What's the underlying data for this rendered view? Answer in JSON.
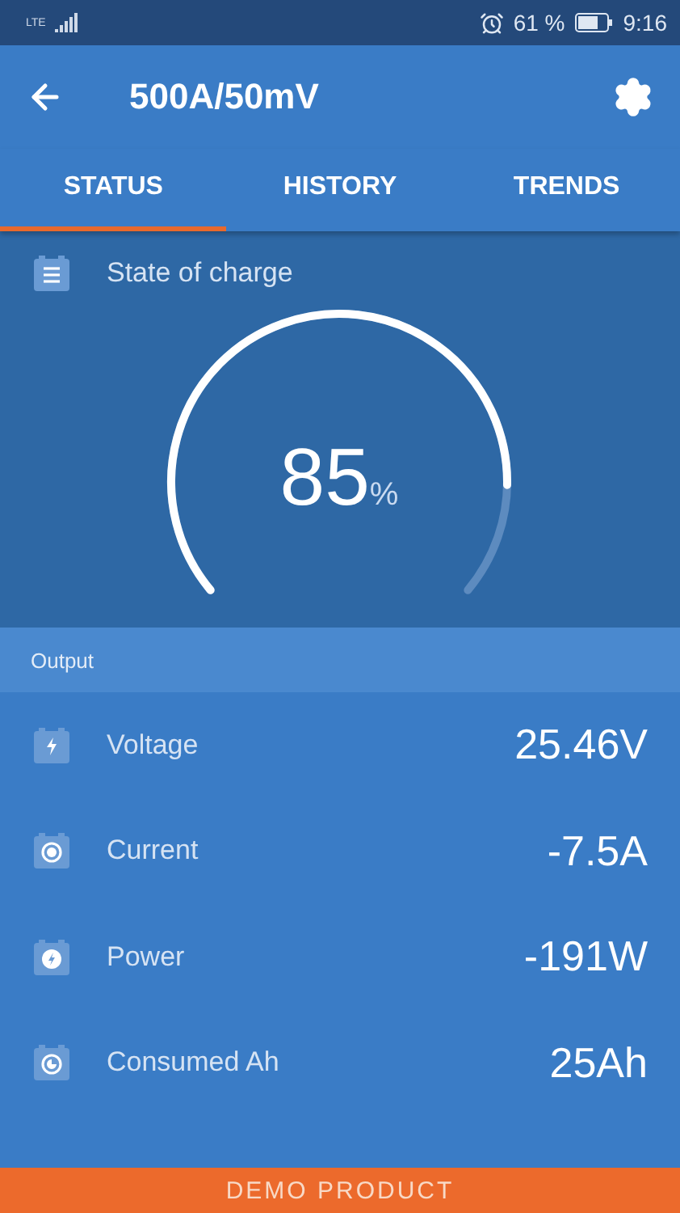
{
  "status_bar": {
    "network": "LTE",
    "battery": "61 %",
    "time": "9:16"
  },
  "header": {
    "title": "500A/50mV"
  },
  "tabs": [
    {
      "label": "STATUS",
      "selected": true
    },
    {
      "label": "HISTORY",
      "selected": false
    },
    {
      "label": "TRENDS",
      "selected": false
    }
  ],
  "state_of_charge": {
    "title": "State of charge",
    "value": "85",
    "unit": "%"
  },
  "output": {
    "title": "Output",
    "rows": [
      {
        "kind": "voltage",
        "label": "Voltage",
        "value": "25.46V"
      },
      {
        "kind": "current",
        "label": "Current",
        "value": "-7.5A"
      },
      {
        "kind": "power",
        "label": "Power",
        "value": "-191W"
      },
      {
        "kind": "consumed",
        "label": "Consumed Ah",
        "value": "25Ah"
      }
    ]
  },
  "banner": "DEMO PRODUCT"
}
